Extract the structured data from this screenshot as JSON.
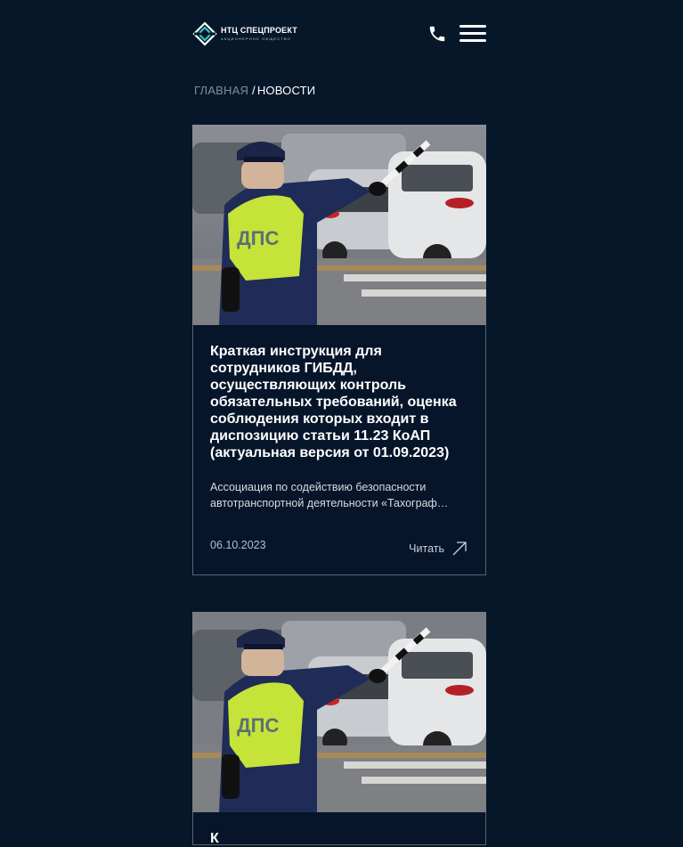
{
  "header": {
    "logo_title": "НТЦ СПЕЦПРОЕКТ",
    "logo_subtitle": "АКЦИОНЕРНОЕ ОБЩЕСТВО",
    "phone_icon": "phone-icon",
    "menu_icon": "hamburger-menu-icon"
  },
  "breadcrumb": {
    "home": "ГЛАВНАЯ",
    "separator": "/",
    "current": "НОВОСТИ"
  },
  "articles": [
    {
      "image": "traffic-police-officer-photo",
      "title": "Краткая инструкция для сотрудников ГИБДД, осуществляющих контроль обязательных требований, оценка соблюдения которых входит в диспозицию статьи 11.23 КоАП (актуальная версия от 01.09.2023)",
      "excerpt_line1": "Ассоциация по содействию безопасности",
      "excerpt_line2": "автотранспортной деятельности «Тахограф…",
      "date": "06.10.2023",
      "read_label": "Читать"
    },
    {
      "image": "traffic-police-officer-photo",
      "title": "К"
    }
  ],
  "colors": {
    "background": "#07172a",
    "card_border": "#5a6470",
    "vest": "#c6e33a",
    "accent_teal": "#33c2c6"
  }
}
